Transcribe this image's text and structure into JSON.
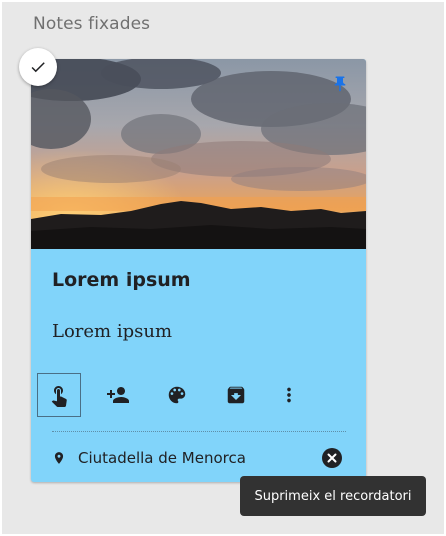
{
  "section": {
    "title": "Notes fixades"
  },
  "note": {
    "title": "Lorem ipsum",
    "body": "Lorem ipsum",
    "background_color": "#81d4fa",
    "pinned": true,
    "selected": true,
    "image": {
      "description_icon": "sunset-landscape-image"
    },
    "toolbar": [
      {
        "icon": "touch-reminder-icon",
        "active": true
      },
      {
        "icon": "add-collaborator-icon",
        "active": false
      },
      {
        "icon": "palette-icon",
        "active": false
      },
      {
        "icon": "archive-icon",
        "active": false
      },
      {
        "icon": "more-vert-icon",
        "active": false
      }
    ],
    "reminder": {
      "icon": "location-pin-icon",
      "label": "Ciutadella de Menorca"
    }
  },
  "tooltip": {
    "text": "Suprimeix el recordatori"
  },
  "colors": {
    "panel_bg": "#e8e8e8",
    "tooltip_bg": "#323232",
    "pin_blue": "#1a73e8",
    "icon_dark": "#202124"
  }
}
